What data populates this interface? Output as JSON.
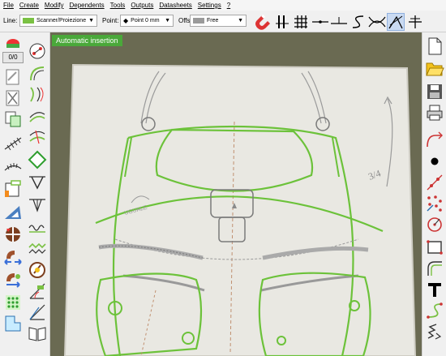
{
  "menu": {
    "items": [
      "File",
      "Create",
      "Modify",
      "Dependents",
      "Tools",
      "Outputs",
      "Datasheets",
      "Settings",
      "?"
    ]
  },
  "toolbar": {
    "line_label": "Line:",
    "line_value": "Scanner/Proiezione",
    "point_label": "Point:",
    "point_value": "Point 0 mm",
    "offset_label": "Offset:",
    "offset_value": "Free",
    "line_color": "#7ac143"
  },
  "left_panel": {
    "counter": "0/0"
  },
  "canvas": {
    "mode_banner": "Automatic insertion",
    "banner_color": "#4aa83a",
    "outline_color": "#6cc23a"
  }
}
